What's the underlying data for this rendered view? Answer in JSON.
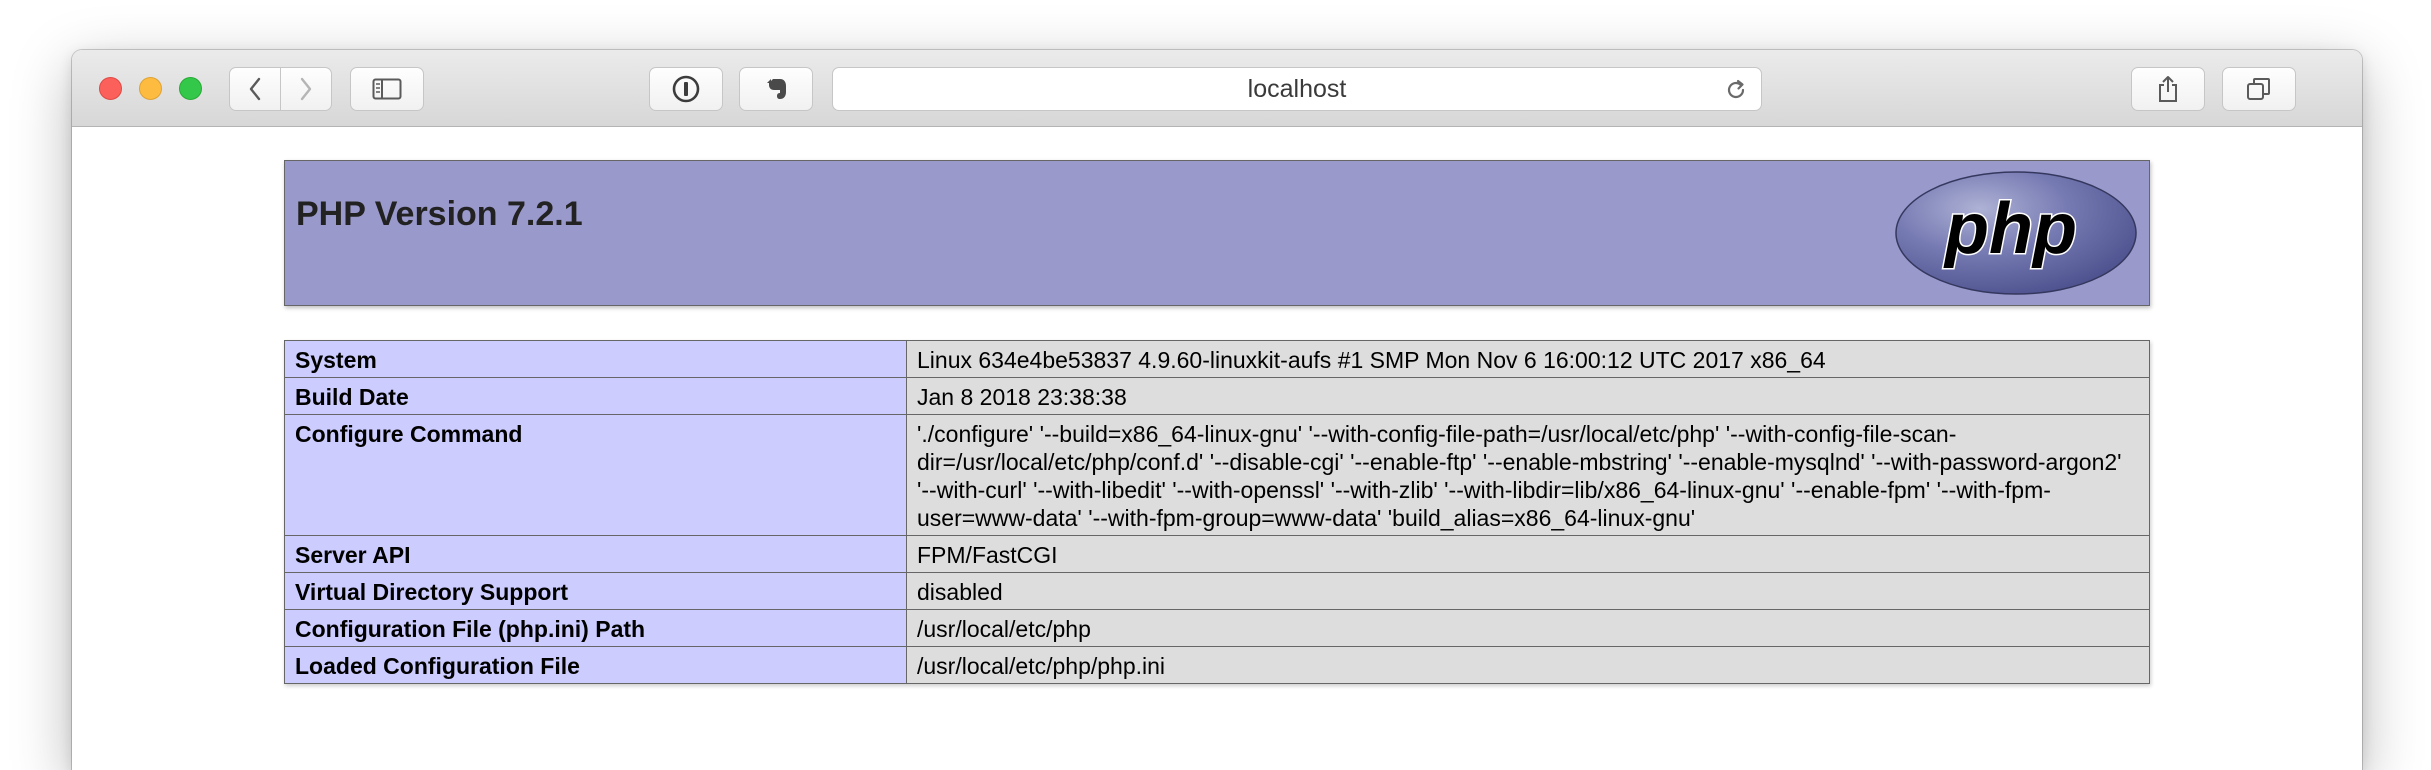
{
  "browser": {
    "address": "localhost"
  },
  "page": {
    "title": "PHP Version 7.2.1",
    "logo_text": "php"
  },
  "info_rows": [
    {
      "label": "System",
      "value": "Linux 634e4be53837 4.9.60-linuxkit-aufs #1 SMP Mon Nov 6 16:00:12 UTC 2017 x86_64"
    },
    {
      "label": "Build Date",
      "value": "Jan 8 2018 23:38:38"
    },
    {
      "label": "Configure Command",
      "value": "'./configure' '--build=x86_64-linux-gnu' '--with-config-file-path=/usr/local/etc/php' '--with-config-file-scan-dir=/usr/local/etc/php/conf.d' '--disable-cgi' '--enable-ftp' '--enable-mbstring' '--enable-mysqlnd' '--with-password-argon2' '--with-curl' '--with-libedit' '--with-openssl' '--with-zlib' '--with-libdir=lib/x86_64-linux-gnu' '--enable-fpm' '--with-fpm-user=www-data' '--with-fpm-group=www-data' 'build_alias=x86_64-linux-gnu'"
    },
    {
      "label": "Server API",
      "value": "FPM/FastCGI"
    },
    {
      "label": "Virtual Directory Support",
      "value": "disabled"
    },
    {
      "label": "Configuration File (php.ini) Path",
      "value": "/usr/local/etc/php"
    },
    {
      "label": "Loaded Configuration File",
      "value": "/usr/local/etc/php/php.ini"
    }
  ],
  "colors": {
    "header_bg": "#9999cc",
    "label_cell_bg": "#ccccff",
    "value_cell_bg": "#dddddd",
    "logo_bg": "#777bb3"
  },
  "icons": [
    "back-icon",
    "forward-icon",
    "sidebar-icon",
    "password-manager-icon",
    "evernote-icon",
    "reload-icon",
    "share-icon",
    "tabs-icon",
    "plus-icon"
  ]
}
